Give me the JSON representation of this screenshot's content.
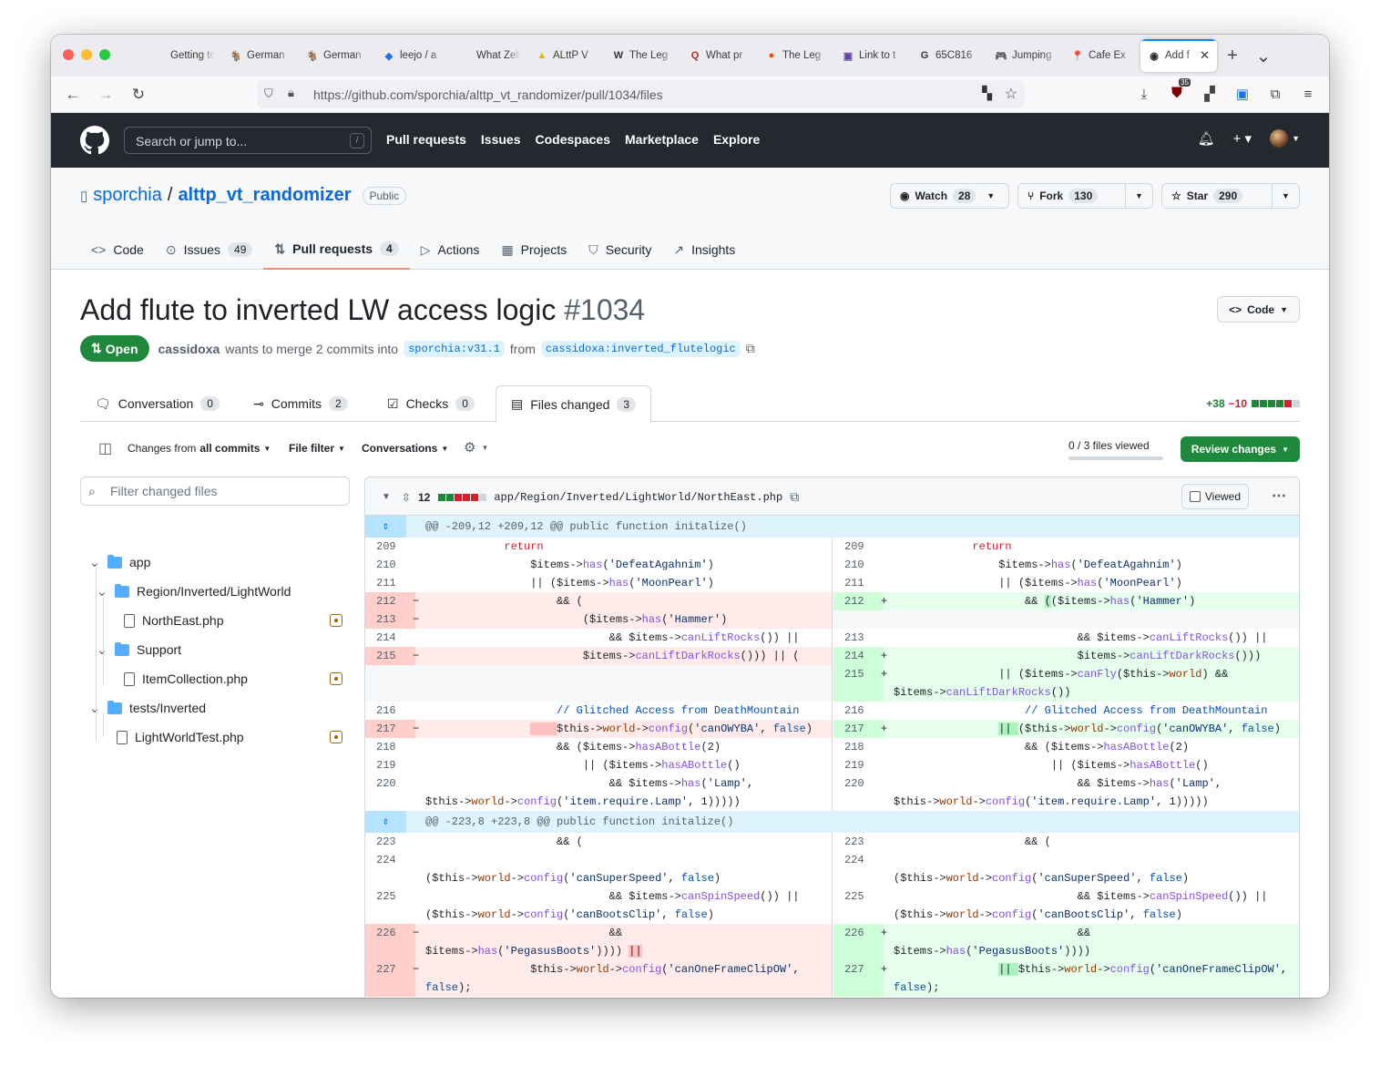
{
  "browser": {
    "tabs": [
      {
        "title": "Getting to C",
        "fav": "",
        "color": "#bbbbbb"
      },
      {
        "title": "German",
        "fav": "🐐",
        "color": "#ffffff"
      },
      {
        "title": "German",
        "fav": "🐐",
        "color": "#ffffff"
      },
      {
        "title": "leejo / a",
        "fav": "◆",
        "color": "#1a73e8"
      },
      {
        "title": "What Zelda",
        "fav": "",
        "color": "#ffffff"
      },
      {
        "title": "ALttP V",
        "fav": "▲",
        "color": "#e3b505"
      },
      {
        "title": "The Leg",
        "fav": "W",
        "color": "#ffffff"
      },
      {
        "title": "What pr",
        "fav": "Q",
        "color": "#b92b27"
      },
      {
        "title": "The Leg",
        "fav": "●",
        "color": "#ff4500"
      },
      {
        "title": "Link to t",
        "fav": "▣",
        "color": "#6441a5"
      },
      {
        "title": "65C816",
        "fav": "G",
        "color": "#ffffff"
      },
      {
        "title": "Jumping",
        "fav": "🎮",
        "color": "#ffffff"
      },
      {
        "title": "Cafe Ex",
        "fav": "📍",
        "color": "#ffffff"
      },
      {
        "title": "Add f",
        "fav": "◉",
        "color": "#24292f",
        "active": true
      }
    ],
    "url": "https://github.com/sporchia/alttp_vt_randomizer/pull/1034/files",
    "notif_count": "35"
  },
  "gh": {
    "search_placeholder": "Search or jump to...",
    "slash": "/",
    "nav": [
      "Pull requests",
      "Issues",
      "Codespaces",
      "Marketplace",
      "Explore"
    ]
  },
  "repo": {
    "owner": "sporchia",
    "sep": "/",
    "name": "alttp_vt_randomizer",
    "visibility": "Public",
    "watch": {
      "label": "Watch",
      "count": "28"
    },
    "fork": {
      "label": "Fork",
      "count": "130"
    },
    "star": {
      "label": "Star",
      "count": "290"
    },
    "nav": [
      {
        "icon": "<>",
        "label": "Code",
        "count": ""
      },
      {
        "icon": "⊙",
        "label": "Issues",
        "count": "49"
      },
      {
        "icon": "⇅",
        "label": "Pull requests",
        "count": "4",
        "active": true
      },
      {
        "icon": "▷",
        "label": "Actions",
        "count": ""
      },
      {
        "icon": "▦",
        "label": "Projects",
        "count": ""
      },
      {
        "icon": "⛉",
        "label": "Security",
        "count": ""
      },
      {
        "icon": "↗",
        "label": "Insights",
        "count": ""
      }
    ]
  },
  "pr": {
    "title": "Add flute to inverted LW access logic",
    "number": "#1034",
    "status": "Open",
    "author": "cassidoxa",
    "merge_text": "wants to merge 2 commits into",
    "base": "sporchia:v31.1",
    "from": "from",
    "head": "cassidoxa:inverted_flutelogic",
    "code_button": "Code",
    "tabs": [
      {
        "label": "Conversation",
        "count": "0"
      },
      {
        "label": "Commits",
        "count": "2"
      },
      {
        "label": "Checks",
        "count": "0"
      },
      {
        "label": "Files changed",
        "count": "3",
        "active": true
      }
    ],
    "additions": "+38",
    "deletions": "−10"
  },
  "filters": {
    "changes_from": "Changes from",
    "all_commits": "all commits",
    "file_filter": "File filter",
    "conversations": "Conversations",
    "viewed": "0 / 3 files viewed",
    "review": "Review changes"
  },
  "tree": {
    "filter_placeholder": "Filter changed files",
    "items": [
      {
        "label": "app",
        "type": "folder",
        "depth": 0
      },
      {
        "label": "Region/Inverted/LightWorld",
        "type": "folder",
        "depth": 1
      },
      {
        "label": "NorthEast.php",
        "type": "file",
        "depth": 2
      },
      {
        "label": "Support",
        "type": "folder",
        "depth": 1
      },
      {
        "label": "ItemCollection.php",
        "type": "file",
        "depth": 2
      },
      {
        "label": "tests/Inverted",
        "type": "folder",
        "depth": 0
      },
      {
        "label": "LightWorldTest.php",
        "type": "file",
        "depth": 1
      }
    ]
  },
  "diff": {
    "count": "12",
    "path": "app/Region/Inverted/LightWorld/NorthEast.php",
    "viewed_label": "Viewed",
    "hunk1": "@@ -209,12 +209,12 @@ public function initalize()",
    "hunk2": "@@ -223,8 +223,8 @@ public function initalize()",
    "rows": [
      {
        "t": "h",
        "text": "@@ -209,12 +209,12 @@ public function initalize()"
      },
      {
        "l": {
          "n": "209",
          "c": "            <span class=k>return</span>"
        },
        "r": {
          "n": "209",
          "c": "            <span class=k>return</span>"
        }
      },
      {
        "l": {
          "n": "210",
          "c": "                $items-><span class=f>has</span>(<span class=s>'DefeatAgahnim'</span>)"
        },
        "r": {
          "n": "210",
          "c": "                $items-><span class=f>has</span>(<span class=s>'DefeatAgahnim'</span>)"
        }
      },
      {
        "l": {
          "n": "211",
          "c": "                || ($items-><span class=f>has</span>(<span class=s>'MoonPearl'</span>)"
        },
        "r": {
          "n": "211",
          "c": "                || ($items-><span class=f>has</span>(<span class=s>'MoonPearl'</span>)"
        }
      },
      {
        "l": {
          "n": "212",
          "t": "del",
          "c": "                    &amp;&amp; ("
        },
        "r": {
          "n": "212",
          "t": "add",
          "c": "                    &amp;&amp; <span class=hl-a>(</span>($items-><span class=f>has</span>(<span class=s>'Hammer'</span>)"
        }
      },
      {
        "l": {
          "n": "213",
          "t": "del",
          "c": "                        ($items-><span class=f>has</span>(<span class=s>'Hammer'</span>)"
        },
        "r": {
          "t": "empty"
        }
      },
      {
        "l": {
          "n": "214",
          "c": "                            &amp;&amp; $items-><span class=f>canLiftRocks</span>()) ||"
        },
        "r": {
          "n": "213",
          "c": "                            &amp;&amp; $items-><span class=f>canLiftRocks</span>()) ||"
        }
      },
      {
        "l": {
          "n": "215",
          "t": "del",
          "c": "                        $items-><span class=f>canLiftDarkRocks</span>())) || ("
        },
        "r": {
          "n": "214",
          "t": "add",
          "c": "                            $items-><span class=f>canLiftDarkRocks</span>()))"
        }
      },
      {
        "l": {
          "t": "empty",
          "h": 2
        },
        "r": {
          "n": "215",
          "t": "add",
          "h": 2,
          "c": "                || ($items-><span class=f>canFly</span>($this-><span class=v>world</span>) &amp;&amp;\n$items-><span class=f>canLiftDarkRocks</span>())"
        }
      },
      {
        "l": {
          "n": "216",
          "c": "                    <span class=n>// Glitched Access from DeathMountain</span>"
        },
        "r": {
          "n": "216",
          "c": "                    <span class=n>// Glitched Access from DeathMountain</span>"
        }
      },
      {
        "l": {
          "n": "217",
          "t": "del",
          "c": "                <span class=hl-d>    </span>$this-><span class=v>world</span>-><span class=f>config</span>(<span class=s>'canOWYBA'</span>, <span class=n>false</span>)"
        },
        "r": {
          "n": "217",
          "t": "add",
          "c": "                <span class=hl-a>|| </span>($this-><span class=v>world</span>-><span class=f>config</span>(<span class=s>'canOWYBA'</span>, <span class=n>false</span>)"
        }
      },
      {
        "l": {
          "n": "218",
          "c": "                    &amp;&amp; ($items-><span class=f>hasABottle</span>(2)"
        },
        "r": {
          "n": "218",
          "c": "                    &amp;&amp; ($items-><span class=f>hasABottle</span>(2)"
        }
      },
      {
        "l": {
          "n": "219",
          "c": "                        || ($items-><span class=f>hasABottle</span>()"
        },
        "r": {
          "n": "219",
          "c": "                        || ($items-><span class=f>hasABottle</span>()"
        }
      },
      {
        "l": {
          "n": "220",
          "h": 2,
          "c": "                            &amp;&amp; $items-><span class=f>has</span>(<span class=s>'Lamp'</span>,\n$this-><span class=v>world</span>-><span class=f>config</span>(<span class=s>'item.require.Lamp'</span>, 1)))))"
        },
        "r": {
          "n": "220",
          "h": 2,
          "c": "                            &amp;&amp; $items-><span class=f>has</span>(<span class=s>'Lamp'</span>,\n$this-><span class=v>world</span>-><span class=f>config</span>(<span class=s>'item.require.Lamp'</span>, 1)))))"
        }
      },
      {
        "t": "h",
        "text": "@@ -223,8 +223,8 @@ public function initalize()"
      },
      {
        "l": {
          "n": "223",
          "c": "                    &amp;&amp; ("
        },
        "r": {
          "n": "223",
          "c": "                    &amp;&amp; ("
        }
      },
      {
        "l": {
          "n": "224",
          "h": 2,
          "c": "\n($this-><span class=v>world</span>-><span class=f>config</span>(<span class=s>'canSuperSpeed'</span>, <span class=n>false</span>)"
        },
        "r": {
          "n": "224",
          "h": 2,
          "c": "\n($this-><span class=v>world</span>-><span class=f>config</span>(<span class=s>'canSuperSpeed'</span>, <span class=n>false</span>)"
        }
      },
      {
        "l": {
          "n": "225",
          "h": 2,
          "c": "                            &amp;&amp; $items-><span class=f>canSpinSpeed</span>()) ||\n($this-><span class=v>world</span>-><span class=f>config</span>(<span class=s>'canBootsClip'</span>, <span class=n>false</span>)"
        },
        "r": {
          "n": "225",
          "h": 2,
          "c": "                            &amp;&amp; $items-><span class=f>canSpinSpeed</span>()) ||\n($this-><span class=v>world</span>-><span class=f>config</span>(<span class=s>'canBootsClip'</span>, <span class=n>false</span>)"
        }
      },
      {
        "l": {
          "n": "226",
          "t": "del",
          "h": 2,
          "c": "                            &amp;&amp;\n$items-><span class=f>has</span>(<span class=s>'PegasusBoots'</span>)))) <span class=hl-d>||</span>"
        },
        "r": {
          "n": "226",
          "t": "add",
          "h": 2,
          "c": "                            &amp;&amp;\n$items-><span class=f>has</span>(<span class=s>'PegasusBoots'</span>))))"
        }
      },
      {
        "l": {
          "n": "227",
          "t": "del",
          "h": 2,
          "c": "                $this-><span class=v>world</span>-><span class=f>config</span>(<span class=s>'canOneFrameClipOW'</span>,\n<span class=n>false</span>);"
        },
        "r": {
          "n": "227",
          "t": "add",
          "h": 2,
          "c": "                <span class=hl-a>|| </span>$this-><span class=v>world</span>-><span class=f>config</span>(<span class=s>'canOneFrameClipOW'</span>,\n<span class=n>false</span>);"
        }
      }
    ]
  }
}
